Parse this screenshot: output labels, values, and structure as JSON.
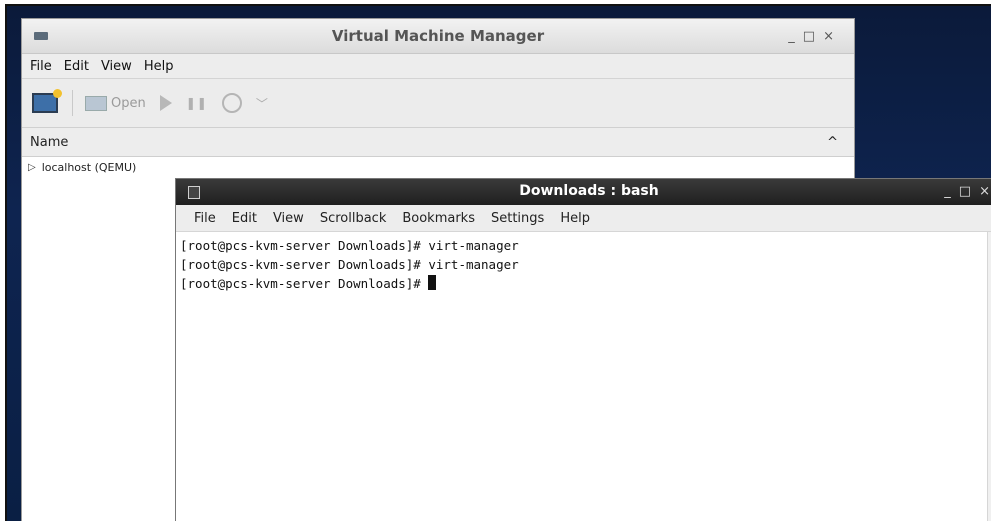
{
  "vmm": {
    "title": "Virtual Machine Manager",
    "menu": [
      "File",
      "Edit",
      "View",
      "Help"
    ],
    "toolbar": {
      "open_label": "Open"
    },
    "list_header": "Name",
    "connections": [
      {
        "label": "localhost (QEMU)"
      }
    ]
  },
  "terminal": {
    "title": "Downloads : bash",
    "menu": [
      "File",
      "Edit",
      "View",
      "Scrollback",
      "Bookmarks",
      "Settings",
      "Help"
    ],
    "lines": [
      "[root@pcs-kvm-server Downloads]# virt-manager",
      "[root@pcs-kvm-server Downloads]# virt-manager",
      "[root@pcs-kvm-server Downloads]# "
    ]
  },
  "window_controls": {
    "minimize": "_",
    "maximize": "□",
    "close": "×"
  }
}
